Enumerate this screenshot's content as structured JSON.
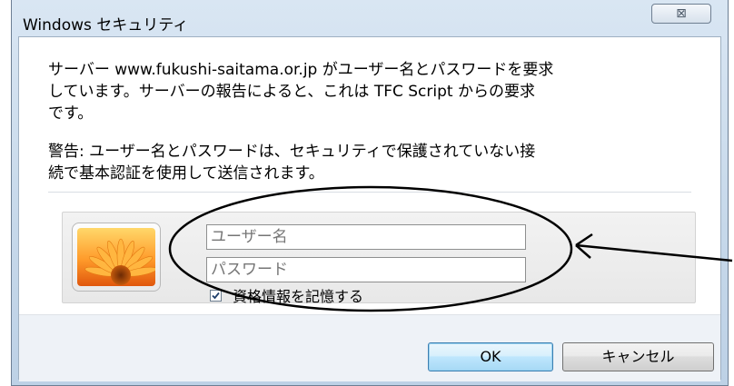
{
  "window": {
    "title": "Windows セキュリティ",
    "close_symbol": "⊠"
  },
  "message": {
    "line1": "サーバー www.fukushi-saitama.or.jp がユーザー名とパスワードを要求",
    "line2": "しています。サーバーの報告によると、これは TFC Script からの要求",
    "line3": "です。"
  },
  "warning": {
    "line1": "警告: ユーザー名とパスワードは、セキュリティで保護されていない接",
    "line2": "続で基本認証を使用して送信されます。"
  },
  "credentials": {
    "username_placeholder": "ユーザー名",
    "password_placeholder": "パスワード",
    "remember_label": "資格情報を記憶する",
    "remember_checked": true,
    "avatar_icon": "orange-flower-avatar-icon"
  },
  "buttons": {
    "ok": "OK",
    "cancel": "キャンセル"
  },
  "annotation": {
    "highlight_shape": "ellipse",
    "pointer": "arrow-left-icon"
  }
}
